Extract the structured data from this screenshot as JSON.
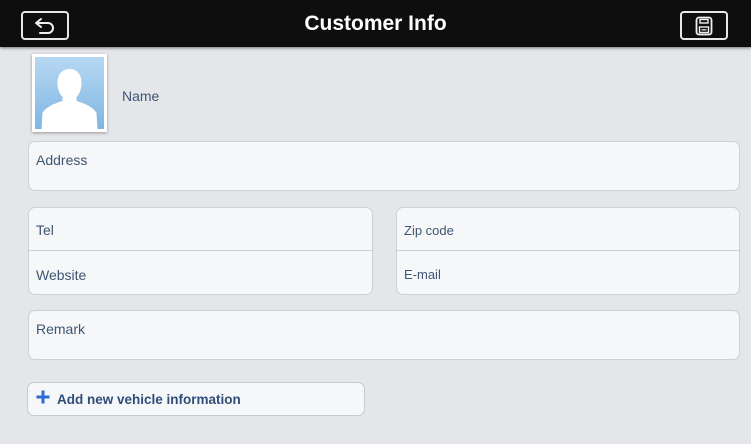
{
  "header": {
    "title": "Customer Info"
  },
  "profile": {
    "name_label": "Name"
  },
  "fields": {
    "address": "Address",
    "tel": "Tel",
    "website": "Website",
    "zip_code": "Zip code",
    "email": "E-mail",
    "remark": "Remark"
  },
  "actions": {
    "add_vehicle": "Add new vehicle information"
  },
  "icons": {
    "back": "back-arrow-icon",
    "save": "save-icon",
    "avatar": "person-silhouette-icon",
    "add": "plus-icon"
  },
  "colors": {
    "topbar": "#0e0e0e",
    "background": "#e4e6ea",
    "label": "#3e5573",
    "accent": "#2f6bd6"
  }
}
